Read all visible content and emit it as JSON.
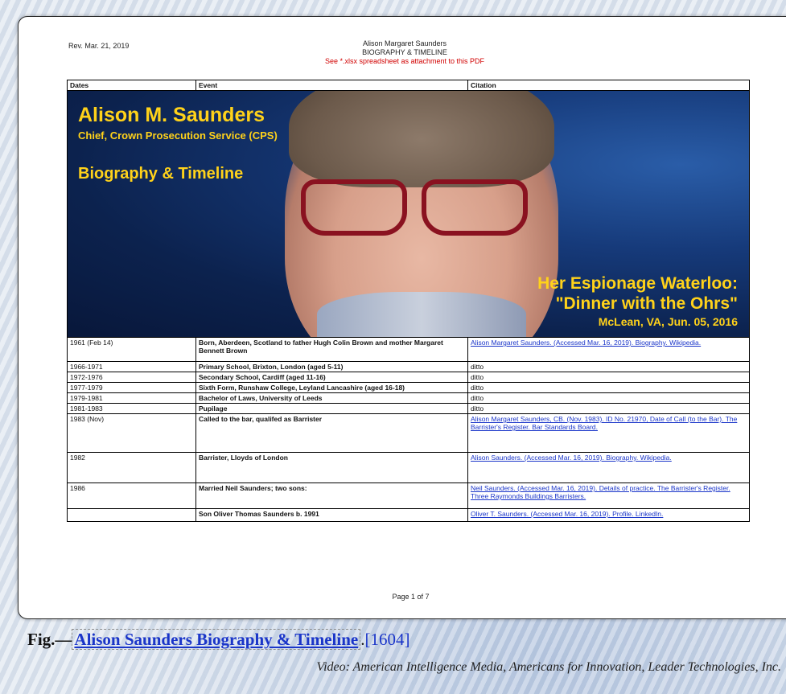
{
  "document": {
    "rev_date": "Rev. Mar. 21, 2019",
    "title_line1": "Alison Margaret Saunders",
    "title_line2": "BIOGRAPHY & TIMELINE",
    "title_note": "See *.xlsx spreadsheet as attachment to this PDF",
    "columns": [
      "Dates",
      "Event",
      "Citation"
    ],
    "hero": {
      "name": "Alison M. Saunders",
      "role": "Chief, Crown Prosecution Service (CPS)",
      "subtitle": "Biography & Timeline",
      "headline1": "Her Espionage Waterloo:",
      "headline2": "\"Dinner with the Ohrs\"",
      "place_date": "McLean, VA, Jun. 05, 2016"
    },
    "rows": [
      {
        "date": "1961 (Feb 14)",
        "event": "Born, Aberdeen, Scotland to father Hugh Colin Brown and mother Margaret Bennett Brown",
        "citation": "Alison Margaret Saunders. (Accessed Mar. 16, 2019). Biography. Wikipedia.",
        "link": true,
        "h": 30
      },
      {
        "date": "1966-1971",
        "event": "Primary School, Brixton, London (aged 5-11)",
        "citation": "ditto",
        "link": false,
        "h": 9
      },
      {
        "date": "1972-1976",
        "event": "Secondary School, Cardiff (aged 11-16)",
        "citation": "ditto",
        "link": false,
        "h": 9
      },
      {
        "date": "1977-1979",
        "event": "Sixth Form, Runshaw College, Leyland Lancashire (aged 16-18)",
        "citation": "ditto",
        "link": false,
        "h": 9
      },
      {
        "date": "1979-1981",
        "event": "Bachelor of Laws, University of Leeds",
        "citation": "ditto",
        "link": false,
        "h": 9
      },
      {
        "date": "1981-1983",
        "event": "Pupilage",
        "citation": "ditto",
        "link": false,
        "h": 9
      },
      {
        "date": "1983 (Nov)",
        "event": "Called to the bar, qualifed as Barrister",
        "citation": "Alison Margaret Saunders, CB. (Nov. 1983). ID No. 21970, Date of Call (to the Bar). The Barrister's Register. Bar Standards Board.",
        "link": true,
        "h": 48
      },
      {
        "date": "1982",
        "event": "Barrister, Lloyds of London",
        "citation": "Alison Saunders. (Accessed Mar. 16, 2019). Biography. Wikipedia.",
        "link": true,
        "h": 38
      },
      {
        "date": "1986",
        "event": "Married Neil Saunders; two sons:",
        "citation": "Neil Saunders. (Accessed Mar. 16, 2019). Details of practice. The Barrister's Register. Three Raymonds Buildings Barristers.",
        "link": true,
        "h": 32
      },
      {
        "date": "",
        "event": "Son Oliver Thomas Saunders b. 1991",
        "citation": "Oliver T. Saunders. (Accessed Mar. 16, 2019). Profile. LinkedIn.",
        "link": true,
        "h": 16
      }
    ],
    "page_label": "Page 1 of 7"
  },
  "caption": {
    "label": "Fig.—",
    "link_text": "Alison Saunders Biography & Timeline",
    "period": ".",
    "ref": "[1604]",
    "credit": "Video: American Intelligence Media, Americans for Innovation, Leader Technologies, Inc."
  }
}
